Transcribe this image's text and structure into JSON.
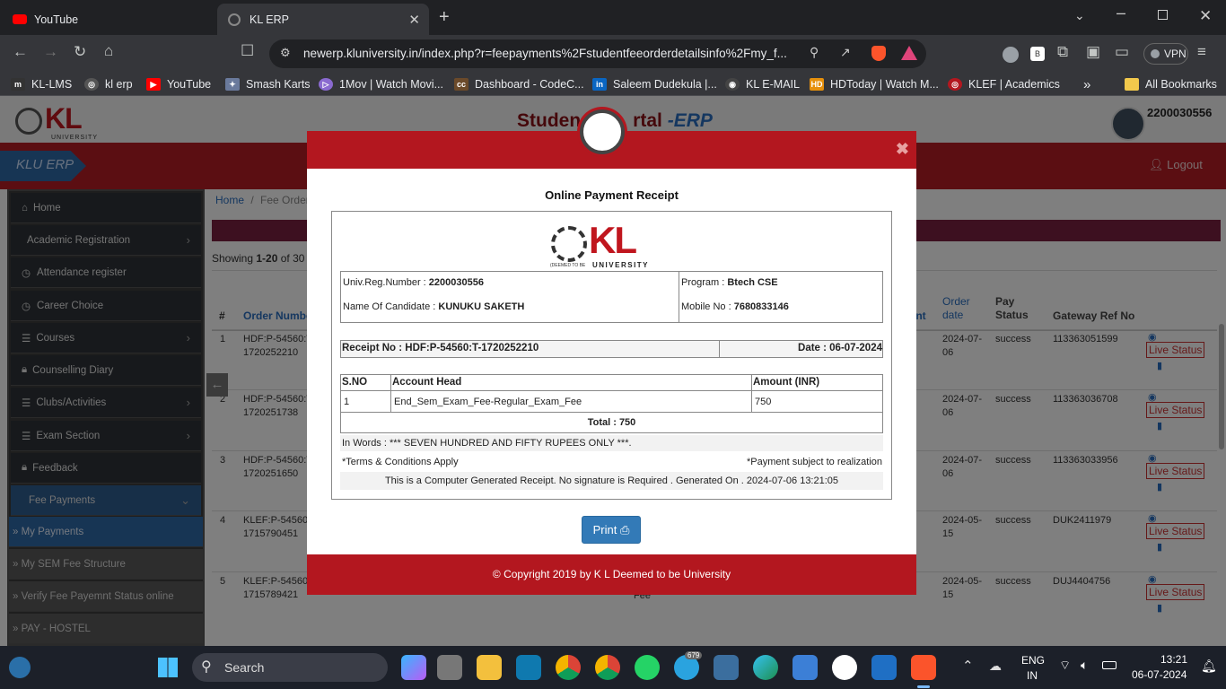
{
  "tabs": [
    {
      "title": "YouTube",
      "icon": "youtube-icon"
    },
    {
      "title": "KL ERP",
      "icon": "klerp-favicon-icon"
    }
  ],
  "url": "newerp.kluniversity.in/index.php?r=feepayments%2Fstudentfeeorderdetailsinfo%2Fmy_f...",
  "vpn_label": "VPN",
  "bookmarks": [
    "KL-LMS",
    "kl erp",
    "YouTube",
    "Smash Karts",
    "1Mov | Watch Movi...",
    "Dashboard - CodeC...",
    "Saleem Dudekula |...",
    "KL E-MAIL",
    "HDToday | Watch M...",
    "KLEF | Academics"
  ],
  "all_bookmarks": "All Bookmarks",
  "header": {
    "portal_title_a": "Studen",
    "portal_title_b": "rtal",
    "portal_title_c": "-ERP",
    "user_id": "2200030556",
    "brand": "KLU ERP",
    "logout": "Logout",
    "logo_text": "KL",
    "logo_sub": "UNIVERSITY"
  },
  "sidebar": {
    "items": [
      "Home",
      "Academic Registration",
      "Attendance register",
      "Career Choice",
      "Courses",
      "Counselling Diary",
      "Clubs/Activities",
      "Exam Section",
      "Feedback",
      "Fee Payments"
    ],
    "sub_items": [
      "» My Payments",
      "» My SEM Fee Structure",
      "» Verify Fee Payemnt Status online",
      "» PAY - HOSTEL"
    ]
  },
  "content": {
    "breadcrumb_home": "Home",
    "breadcrumb_sep": "/",
    "breadcrumb_current": "Fee Order",
    "showing_prefix": "Showing",
    "showing_range": "1-20",
    "showing_of": "of 30",
    "headers": {
      "num": "#",
      "order_number": "Order Numbe",
      "nt": "unt",
      "order_date": "Order date",
      "pay_status": "Pay Status",
      "gateway": "Gateway Ref No"
    },
    "rows": [
      {
        "n": "1",
        "order": "HDF:P-54560:T-",
        "order2": "1720252210",
        "date": "2024-07-",
        "date2": "06",
        "status": "success",
        "ref": "113363051599"
      },
      {
        "n": "2",
        "order": "HDF:P-54560:T-",
        "order2": "1720251738",
        "date": "2024-07-",
        "date2": "06",
        "status": "success",
        "ref": "113363036708"
      },
      {
        "n": "3",
        "order": "HDF:P-54560:T-",
        "order2": "1720251650",
        "date": "2024-07-",
        "date2": "06",
        "status": "success",
        "ref": "113363033956"
      },
      {
        "n": "4",
        "order": "KLEF:P-54560",
        "order2": "1715790451",
        "date": "2024-05-",
        "date2": "15",
        "status": "success",
        "ref": "DUK2411979"
      },
      {
        "n": "5",
        "order": "KLEF:P-54560",
        "order2": "1715789421",
        "date": "2024-05-",
        "date2": "15",
        "status": "success",
        "ref": "DUJ4404756"
      }
    ],
    "fee_fragment": "Fee",
    "live_status": "Live Status"
  },
  "receipt": {
    "title": "Online Payment Receipt",
    "reg_label": "Univ.Reg.Number : ",
    "reg_value": "2200030556",
    "program_label": "Program : ",
    "program_value": "Btech CSE",
    "name_label": "Name Of Candidate : ",
    "name_value": "KUNUKU SAKETH",
    "mobile_label": "Mobile No : ",
    "mobile_value": "7680833146",
    "receipt_no": "Receipt No : HDF:P-54560:T-1720252210",
    "date": "Date : 06-07-2024",
    "col_sno": "S.NO",
    "col_head": "Account Head",
    "col_amount": "Amount (INR)",
    "row_sno": "1",
    "row_head": "End_Sem_Exam_Fee-Regular_Exam_Fee",
    "row_amount": "750",
    "total": "Total : 750",
    "in_words": "In Words : *** SEVEN HUNDRED AND FIFTY RUPEES ONLY ***.",
    "terms": "*Terms & Conditions Apply",
    "realization": "*Payment subject to realization",
    "generated": "This is a Computer Generated Receipt. No signature is Required . Generated On . 2024-07-06 13:21:05",
    "print": "Print",
    "copyright": "© Copyright 2019 by K L Deemed to be University",
    "logo_text": "KL",
    "logo_sub": "UNIVERSITY",
    "logo_deemed": "(DEEMED TO BE"
  },
  "taskbar": {
    "search": "Search",
    "lang1": "ENG",
    "lang2": "IN",
    "time": "13:21",
    "date": "06-07-2024",
    "telegram_badge": "679"
  },
  "colors": {
    "accent_red": "#b3171f",
    "link_blue": "#2a6fc0",
    "print_blue": "#337ab7"
  }
}
